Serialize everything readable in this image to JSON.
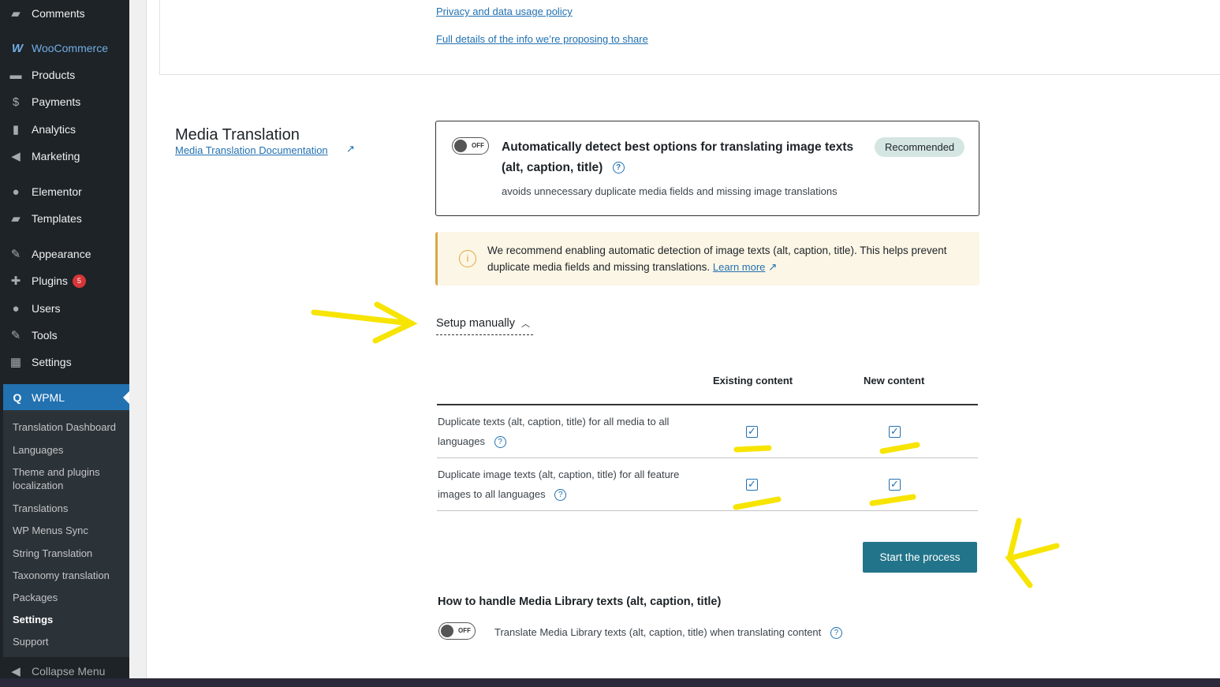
{
  "sidebar": {
    "items": [
      {
        "label": "Comments",
        "icon": "comment-icon"
      },
      {
        "label": "WooCommerce",
        "icon": "woo-icon"
      },
      {
        "label": "Products",
        "icon": "archive-icon"
      },
      {
        "label": "Payments",
        "icon": "dollar-icon"
      },
      {
        "label": "Analytics",
        "icon": "chart-icon"
      },
      {
        "label": "Marketing",
        "icon": "megaphone-icon"
      },
      {
        "label": "Elementor",
        "icon": "elementor-icon"
      },
      {
        "label": "Templates",
        "icon": "folder-icon"
      },
      {
        "label": "Appearance",
        "icon": "brush-icon"
      },
      {
        "label": "Plugins",
        "icon": "plugin-icon",
        "badge": "5"
      },
      {
        "label": "Users",
        "icon": "user-icon"
      },
      {
        "label": "Tools",
        "icon": "wrench-icon"
      },
      {
        "label": "Settings",
        "icon": "settings-icon"
      }
    ],
    "wpml": "WPML",
    "submenu": [
      "Translation Dashboard",
      "Languages",
      "Theme and plugins localization",
      "Translations",
      "WP Menus Sync",
      "String Translation",
      "Taxonomy translation",
      "Packages",
      "Settings",
      "Support"
    ],
    "collapse": "Collapse Menu"
  },
  "top": {
    "privacy": "Privacy and data usage policy",
    "details": "Full details of the info we’re proposing to share"
  },
  "media": {
    "title": "Media Translation",
    "doc_link": "Media Translation Documentation",
    "auto_title": "Automatically detect best options for translating image texts (alt, caption, title)",
    "toggle": "OFF",
    "badge": "Recommended",
    "auto_desc": "avoids unnecessary duplicate media fields and missing image translations",
    "notice": "We recommend enabling automatic detection of image texts (alt, caption, title). This helps prevent duplicate media fields and missing translations.",
    "learn_more": "Learn more",
    "setup": "Setup manually",
    "col_existing": "Existing content",
    "col_new": "New content",
    "rows": [
      {
        "label": "Duplicate texts (alt, caption, title) for all media to all languages",
        "existing": true,
        "new": true
      },
      {
        "label": "Duplicate image texts (alt, caption, title) for all feature images to all languages",
        "existing": true,
        "new": true
      }
    ],
    "start": "Start the process",
    "library_title": "How to handle Media Library texts (alt, caption, title)",
    "library_toggle": "OFF",
    "library_label": "Translate Media Library texts (alt, caption, title) when translating content"
  }
}
